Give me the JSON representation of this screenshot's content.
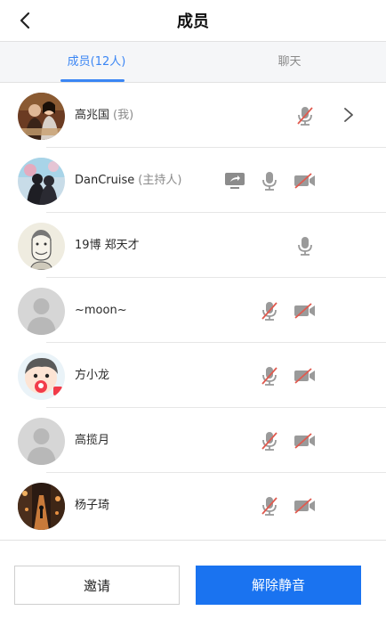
{
  "header": {
    "title": "成员"
  },
  "tabs": [
    {
      "label": "成员(12人)",
      "active": true
    },
    {
      "label": "聊天",
      "active": false
    }
  ],
  "members": [
    {
      "name": "高兆国",
      "tag": "(我)",
      "avatar": "photo-couple-poster",
      "icons": [
        "mic-off"
      ],
      "chevron": true
    },
    {
      "name": "DanCruise",
      "tag": "(主持人)",
      "avatar": "photo-silhouette-couple",
      "icons": [
        "screen-share",
        "mic-on",
        "video-off"
      ]
    },
    {
      "name": "19博   郑天才",
      "tag": "",
      "avatar": "sketch-face",
      "icons": [
        "mic-on"
      ]
    },
    {
      "name": "~moon~",
      "tag": "",
      "avatar": "default-person",
      "icons": [
        "mic-off",
        "video-off"
      ]
    },
    {
      "name": "方小龙",
      "tag": "",
      "avatar": "cartoon-boy",
      "icons": [
        "mic-off",
        "video-off"
      ]
    },
    {
      "name": "高揽月",
      "tag": "",
      "avatar": "default-person",
      "icons": [
        "mic-off",
        "video-off"
      ]
    },
    {
      "name": "杨子琦",
      "tag": "",
      "avatar": "photo-street-night",
      "icons": [
        "mic-off",
        "video-off"
      ]
    }
  ],
  "footer": {
    "invite_label": "邀请",
    "unmute_all_label": "解除静音"
  },
  "colors": {
    "accent": "#3b86f4",
    "primary_button": "#1a73f0",
    "icon_gray": "#9a9a9a",
    "muted_red": "#e05a4f"
  }
}
